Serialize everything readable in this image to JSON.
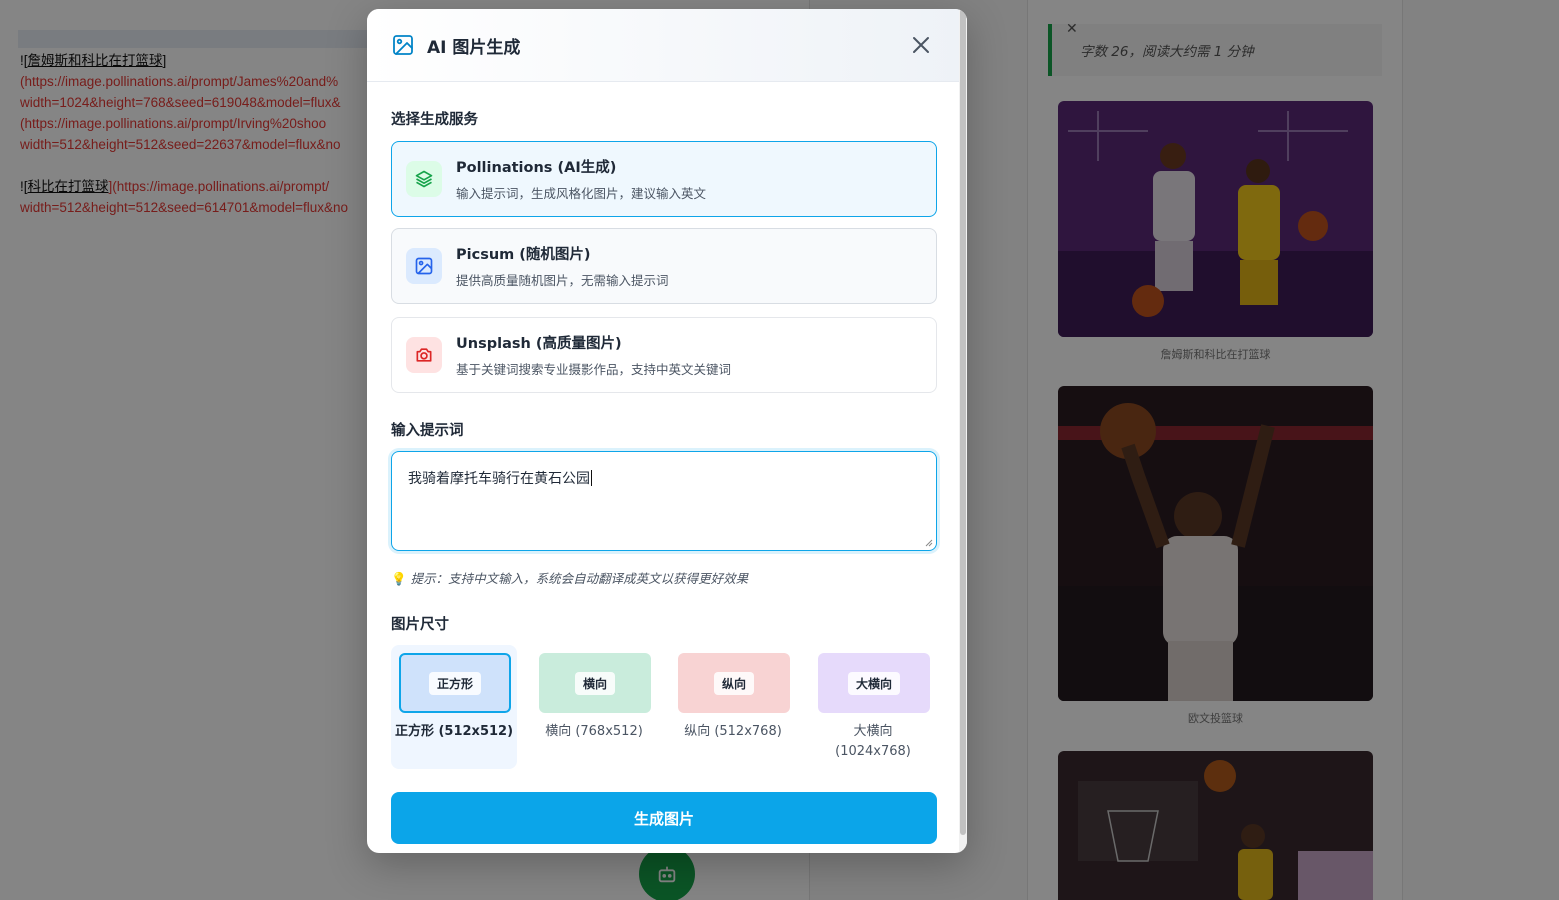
{
  "background": {
    "editor_lines": [
      {
        "prefix": "![",
        "link": "詹姆斯和科比在打篮球",
        "suffix": "]"
      },
      {
        "text": "(https://image.pollinations.ai/prompt/James%20and%"
      },
      {
        "text": "width=1024&height=768&seed=619048&model=flux&"
      },
      {
        "text": "(https://image.pollinations.ai/prompt/Irving%20shoo"
      },
      {
        "text": "width=512&height=512&seed=22637&model=flux&no"
      },
      {
        "text": ""
      },
      {
        "prefix": "![",
        "link": "科比在打篮球",
        "suffix": "](https://image.pollinations.ai/prompt/"
      },
      {
        "text": "width=512&height=512&seed=614701&model=flux&no"
      }
    ],
    "read_time": "字数 26，阅读大约需 1 分钟",
    "captions": [
      "詹姆斯和科比在打篮球",
      "欧文投篮球"
    ]
  },
  "modal": {
    "title": "AI 图片生成",
    "service_label": "选择生成服务",
    "services": [
      {
        "name": "Pollinations (AI生成)",
        "desc": "输入提示词，生成风格化图片，建议输入英文",
        "icon": "layers-icon"
      },
      {
        "name": "Picsum (随机图片)",
        "desc": "提供高质量随机图片，无需输入提示词",
        "icon": "image-icon"
      },
      {
        "name": "Unsplash (高质量图片)",
        "desc": "基于关键词搜索专业摄影作品，支持中英文关键词",
        "icon": "camera-icon"
      }
    ],
    "prompt_label": "输入提示词",
    "prompt_value": "我骑着摩托车骑行在黄石公园",
    "hint": "提示：支持中文输入，系统会自动翻译成英文以获得更好效果",
    "size_label": "图片尺寸",
    "sizes": [
      {
        "chip": "正方形",
        "caption": "正方形 (512x512)",
        "color": "#cfe2fb"
      },
      {
        "chip": "横向",
        "caption": "横向 (768x512)",
        "color": "#c9ecdc"
      },
      {
        "chip": "纵向",
        "caption": "纵向 (512x768)",
        "color": "#f8d3d3"
      },
      {
        "chip": "大横向",
        "caption": "大横向\n(1024x768)",
        "color": "#e6dafb"
      }
    ],
    "generate_label": "生成图片",
    "colors": {
      "accent": "#0ba5e9",
      "selected_bg": "#eff8fe"
    }
  }
}
